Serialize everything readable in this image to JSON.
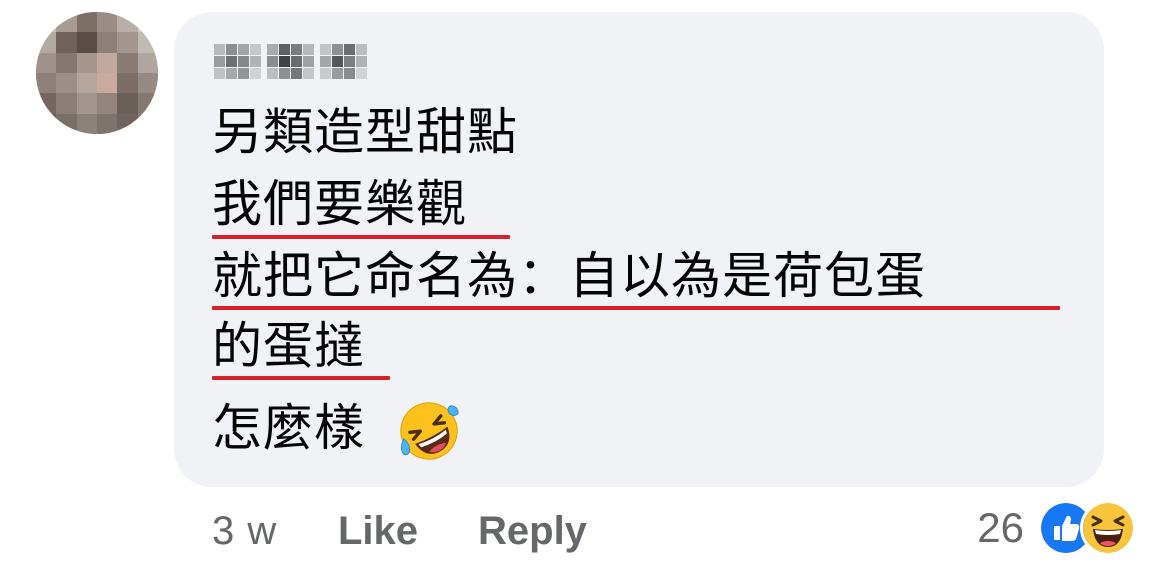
{
  "comment": {
    "author_name": "",
    "lines": [
      "另類造型甜點",
      "我們要樂觀",
      "就把它命名為：自以為是荷包蛋",
      "的蛋撻",
      "怎麼樣"
    ],
    "emoji": "rolling-on-floor-laughing-emoji"
  },
  "actions": {
    "time": "3 w",
    "like_label": "Like",
    "reply_label": "Reply"
  },
  "reactions": {
    "count": "26",
    "icons": [
      "like-reaction-icon",
      "haha-reaction-icon"
    ]
  },
  "colors": {
    "bubble": "#f0f2f5",
    "text": "#050505",
    "meta": "#65676b",
    "underline": "#d6202a",
    "like_blue": "#1877f2"
  }
}
